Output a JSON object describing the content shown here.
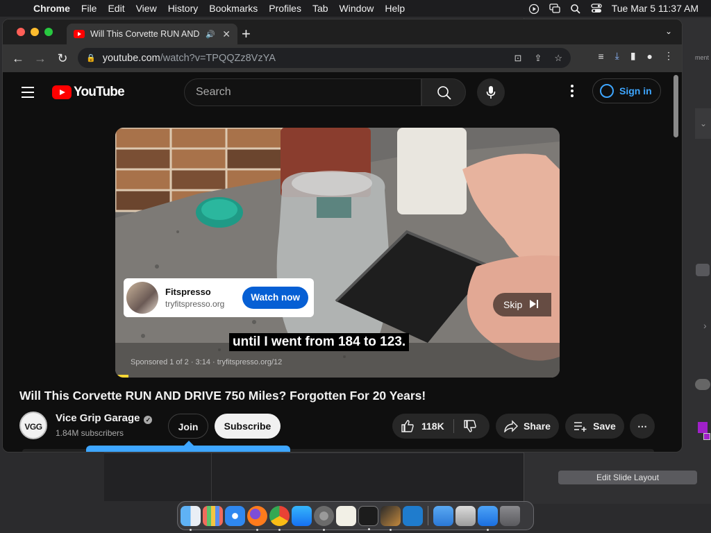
{
  "menubar": {
    "app": "Chrome",
    "items": [
      "File",
      "Edit",
      "View",
      "History",
      "Bookmarks",
      "Profiles",
      "Tab",
      "Window",
      "Help"
    ],
    "clock": "Tue Mar 5  11:37 AM"
  },
  "browser": {
    "tab_title": "Will This Corvette RUN AND",
    "url_host": "youtube.com",
    "url_path": "/watch?v=TPQQZz8VzYA"
  },
  "youtube": {
    "logo_text": "YouTube",
    "search_placeholder": "Search",
    "signin_label": "Sign in",
    "ad": {
      "advertiser": "Fitspresso",
      "domain": "tryfitspresso.org",
      "cta": "Watch now",
      "skip_label": "Skip",
      "info": "Sponsored 1 of 2 · 3:14 · tryfitspresso.org/12",
      "progress_fraction": 0.03
    },
    "caption": "until I went from 184 to 123.",
    "video_title": "Will This Corvette RUN AND DRIVE 750 Miles? Forgotten For 20 Years!",
    "channel": {
      "avatar_text": "VGG",
      "name": "Vice Grip Garage",
      "subscribers": "1.84M subscribers"
    },
    "buttons": {
      "join": "Join",
      "subscribe": "Subscribe",
      "likes": "118K",
      "share": "Share",
      "save": "Save"
    }
  },
  "background_app": {
    "edit_slide_layout": "Edit Slide Layout",
    "fragment_text": "ment"
  },
  "dock": {
    "apps": [
      "finder",
      "launchpad",
      "safari",
      "firefox",
      "chrome",
      "app-store",
      "system-settings",
      "textedit",
      "terminal",
      "keynote-brush",
      "vscode",
      "weather-folder",
      "preview",
      "keynote",
      "trash"
    ]
  },
  "colors": {
    "youtube_red": "#ff0000",
    "youtube_blue": "#3ea6ff",
    "cta_blue": "#065fd4"
  }
}
